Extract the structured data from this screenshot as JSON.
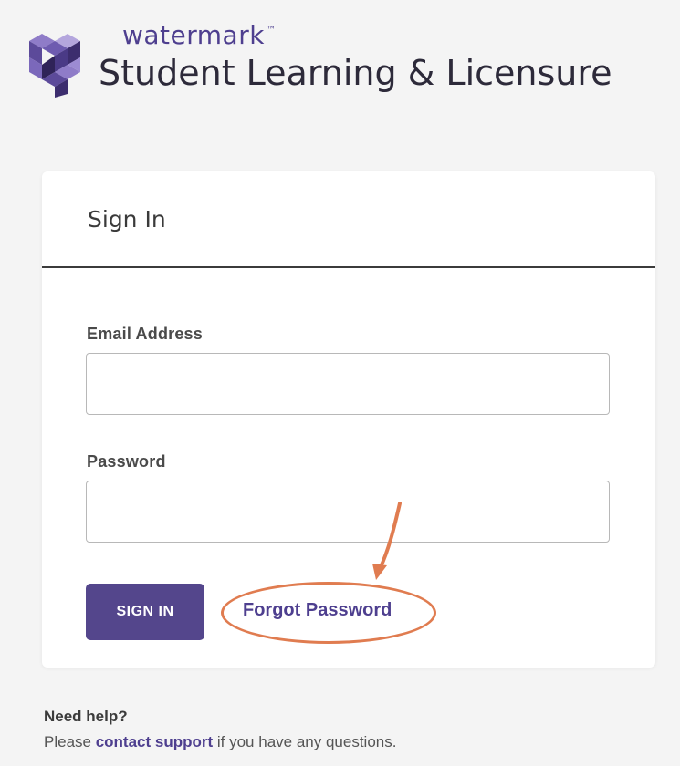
{
  "brand": {
    "name": "watermark",
    "trademark": "™",
    "product": "Student Learning & Licensure",
    "accent_color": "#4e3f8f"
  },
  "card": {
    "title": "Sign In",
    "email": {
      "label": "Email Address",
      "value": "",
      "placeholder": ""
    },
    "password": {
      "label": "Password",
      "value": "",
      "placeholder": ""
    },
    "sign_in_button": "SIGN IN",
    "forgot_link": "Forgot Password",
    "button_color": "#54468c"
  },
  "annotation": {
    "color": "#e07c50"
  },
  "help": {
    "title": "Need help?",
    "before_link": "Please ",
    "link": "contact support",
    "after_link": " if you have any questions."
  }
}
